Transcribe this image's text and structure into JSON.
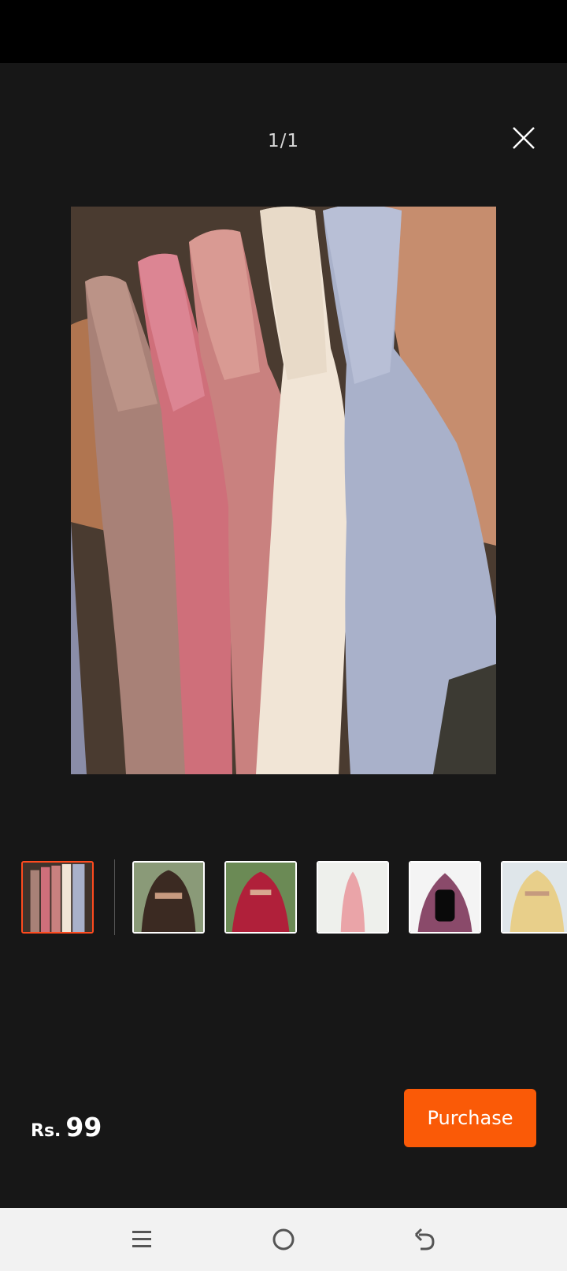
{
  "viewer": {
    "counter": "1/1",
    "close_icon": "close-icon"
  },
  "thumbnails": [
    {
      "name": "thumb-scrunchie-hijabs",
      "selected": true
    },
    {
      "name": "thumb-brown-niqab",
      "selected": false
    },
    {
      "name": "thumb-red-niqab",
      "selected": false
    },
    {
      "name": "thumb-pink-khimar",
      "selected": false
    },
    {
      "name": "thumb-mauve-niqab",
      "selected": false
    },
    {
      "name": "thumb-yellow-niqab",
      "selected": false
    }
  ],
  "footer": {
    "currency": "Rs.",
    "price": "99",
    "purchase_label": "Purchase"
  },
  "nav": {
    "icons": [
      "menu-icon",
      "home-icon",
      "back-icon"
    ]
  },
  "colors": {
    "background": "#171717",
    "accent": "#fa5a07",
    "selected_border": "#ff4b1f",
    "nav_background": "#f2f2f2"
  }
}
